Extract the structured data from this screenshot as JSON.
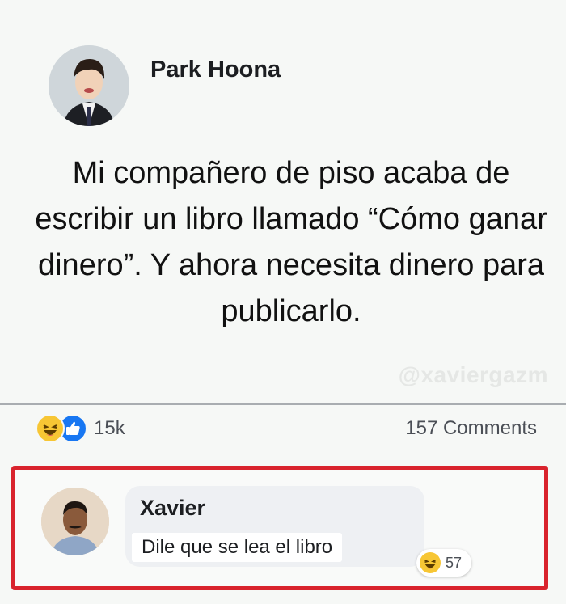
{
  "post": {
    "author": "Park Hoona",
    "text": "Mi compañero de piso acaba de escribir un libro llamado “Cómo ganar dinero”. Y ahora necesita dinero para publicarlo.",
    "watermark": "@xaviergazm"
  },
  "stats": {
    "reaction_icons": [
      "haha-icon",
      "like-icon"
    ],
    "reaction_count": "15k",
    "comments": "157 Comments"
  },
  "comment": {
    "author": "Xavier",
    "text": "Dile que se lea el libro",
    "reaction_icon": "haha-icon",
    "reaction_count": "57",
    "highlight_color": "#d9232d"
  },
  "colors": {
    "like": "#1877f2",
    "haha": "#f7c634",
    "background": "#f6f8f6"
  }
}
